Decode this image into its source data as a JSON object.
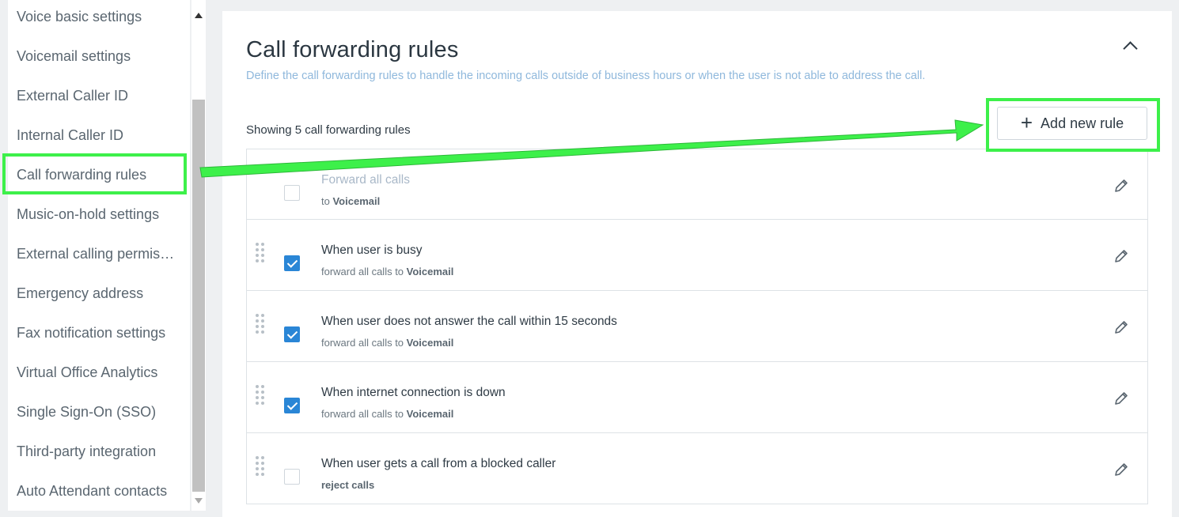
{
  "sidebar": {
    "items": [
      {
        "label": "Voice basic settings"
      },
      {
        "label": "Voicemail settings"
      },
      {
        "label": "External Caller ID"
      },
      {
        "label": "Internal Caller ID"
      },
      {
        "label": "Call forwarding rules"
      },
      {
        "label": "Music-on-hold settings"
      },
      {
        "label": "External calling permissions"
      },
      {
        "label": "Emergency address"
      },
      {
        "label": "Fax notification settings"
      },
      {
        "label": "Virtual Office Analytics"
      },
      {
        "label": "Single Sign-On (SSO)"
      },
      {
        "label": "Third-party integration"
      },
      {
        "label": "Auto Attendant contacts"
      }
    ],
    "selected": "Call forwarding rules"
  },
  "main": {
    "title": "Call forwarding rules",
    "subtitle": "Define the call forwarding rules to handle the incoming calls outside of business hours or when the user is not able to address the call.",
    "count_text": "Showing 5 call forwarding rules",
    "add_button_label": "Add new rule",
    "collapse_icon": "chevron-up-icon"
  },
  "rules": [
    {
      "title": "Forward all calls",
      "sub_prefix": "to ",
      "sub_target": "Voicemail",
      "checked": false,
      "disabled": true,
      "draggable": false
    },
    {
      "title": "When user is busy",
      "sub_prefix": "forward all calls to ",
      "sub_target": "Voicemail",
      "checked": true,
      "disabled": false,
      "draggable": true
    },
    {
      "title": "When user does not answer the call within 15 seconds",
      "sub_prefix": "forward all calls to ",
      "sub_target": "Voicemail",
      "checked": true,
      "disabled": false,
      "draggable": true
    },
    {
      "title": "When internet connection is down",
      "sub_prefix": "forward all calls to ",
      "sub_target": "Voicemail",
      "checked": true,
      "disabled": false,
      "draggable": true
    },
    {
      "title": "When user gets a call from a blocked caller",
      "sub_prefix": "",
      "sub_target": "reject calls",
      "checked": false,
      "disabled": false,
      "draggable": true
    }
  ],
  "colors": {
    "highlight": "#3df04a",
    "accent": "#2a86d6",
    "subtitle": "#8fb8dc"
  }
}
